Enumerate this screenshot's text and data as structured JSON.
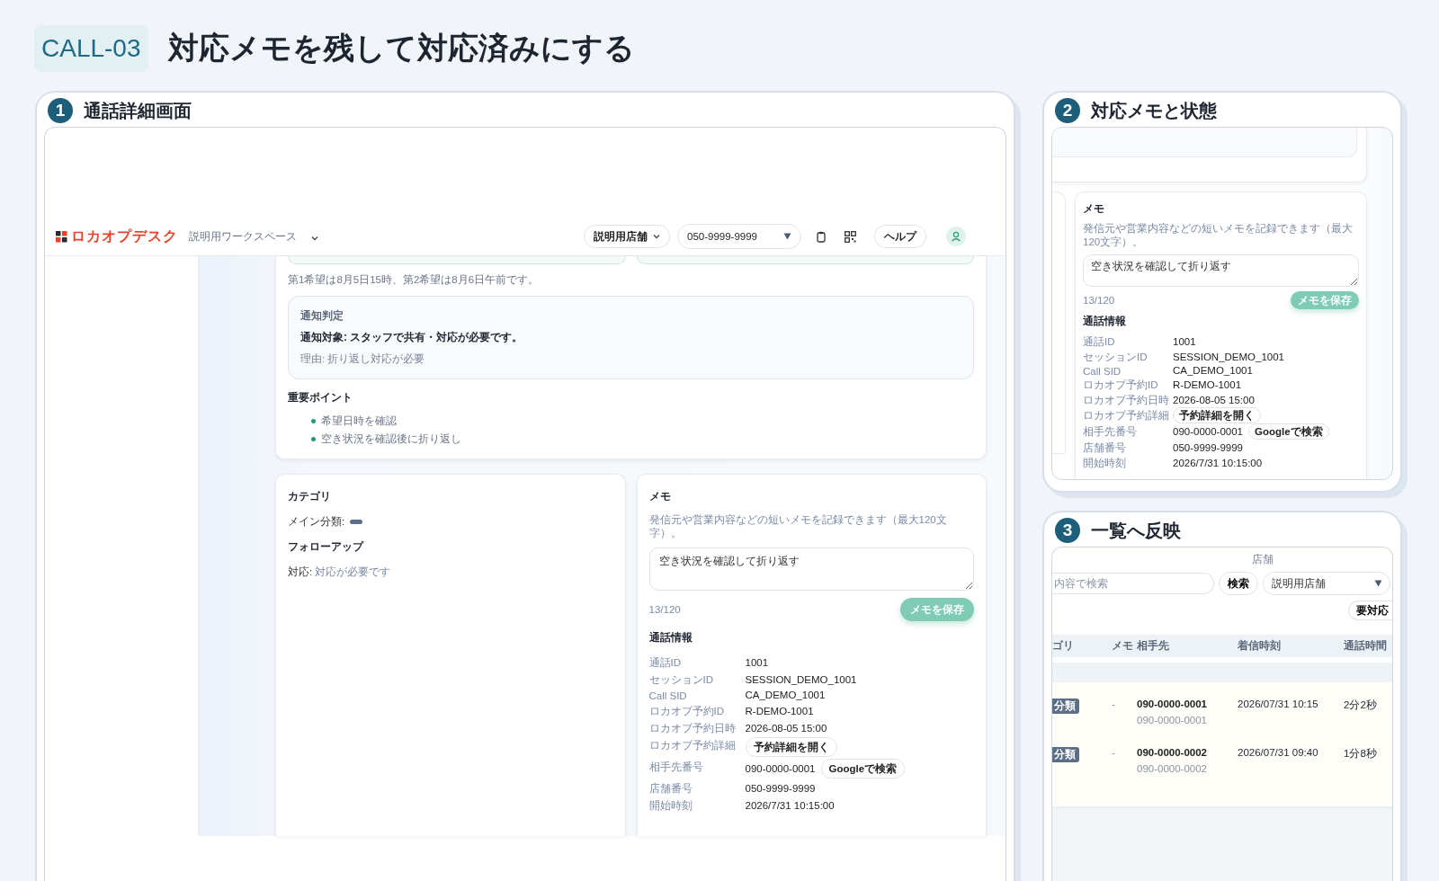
{
  "header": {
    "badge": "CALL-03",
    "title": "対応メモを残して対応済みにする"
  },
  "panel_1": {
    "number": "1",
    "title": "通話詳細画面",
    "app_bar": {
      "logo": "ロカオプデスク",
      "workspace": "説明用ワークスペース",
      "store_button": "説明用店舗",
      "phone_select": "050-9999-9999",
      "help": "ヘルプ"
    },
    "summary_note": "第1希望は8月5日15時、第2希望は8月6日午前です。",
    "notification": {
      "label": "通知判定",
      "text": "通知対象: スタッフで共有・対応が必要です。",
      "reason": "理由: 折り返し対応が必要"
    },
    "key_points": {
      "title": "重要ポイント",
      "items": [
        "希望日時を確認",
        "空き状況を確認後に折り返し"
      ]
    },
    "category": {
      "title": "カテゴリ",
      "main_label": "メイン分類:",
      "followup_title": "フォローアップ",
      "action_label": "対応:",
      "action_value": "対応が必要です"
    },
    "memo": {
      "title": "メモ",
      "hint": "発信元や営業内容などの短いメモを記録できます（最大120文字）。",
      "value": "空き状況を確認して折り返す",
      "count": "13/120",
      "save": "メモを保存",
      "info_title": "通話情報",
      "info": [
        {
          "label": "通話ID",
          "value": "1001"
        },
        {
          "label": "セッションID",
          "value": "SESSION_DEMO_1001"
        },
        {
          "label": "Call SID",
          "value": "CA_DEMO_1001"
        },
        {
          "label": "ロカオプ予約ID",
          "value": "R-DEMO-1001"
        },
        {
          "label": "ロカオプ予約日時",
          "value": "2026-08-05 15:00"
        },
        {
          "label": "ロカオプ予約詳細",
          "button": "予約詳細を開く"
        },
        {
          "label": "相手先番号",
          "value": "090-0000-0001",
          "button": "Googleで検索"
        },
        {
          "label": "店舗番号",
          "value": "050-9999-9999"
        },
        {
          "label": "開始時刻",
          "value": "2026/7/31 10:15:00"
        }
      ]
    }
  },
  "panel_2": {
    "number": "2",
    "title": "対応メモと状態",
    "memo": {
      "title": "メモ",
      "hint": "発信元や営業内容などの短いメモを記録できます（最大120文字）。",
      "value": "空き状況を確認して折り返す",
      "count": "13/120",
      "save": "メモを保存",
      "info_title": "通話情報",
      "info": [
        {
          "label": "通話ID",
          "value": "1001"
        },
        {
          "label": "セッションID",
          "value": "SESSION_DEMO_1001"
        },
        {
          "label": "Call SID",
          "value": "CA_DEMO_1001"
        },
        {
          "label": "ロカオプ予約ID",
          "value": "R-DEMO-1001"
        },
        {
          "label": "ロカオプ予約日時",
          "value": "2026-08-05 15:00"
        },
        {
          "label": "ロカオプ予約詳細",
          "button": "予約詳細を開く"
        },
        {
          "label": "相手先番号",
          "value": "090-0000-0001",
          "button": "Googleで検索"
        },
        {
          "label": "店舗番号",
          "value": "050-9999-9999"
        },
        {
          "label": "開始時刻",
          "value": "2026/7/31 10:15:00"
        }
      ]
    }
  },
  "panel_3": {
    "number": "3",
    "title": "一覧へ反映",
    "store_label": "店舗",
    "search_placeholder": "内容で検索",
    "search_button": "検索",
    "store_select": "説明用店舗",
    "filter_button": "要対応",
    "columns": [
      "ゴリ",
      "メモ",
      "相手先",
      "着信時刻",
      "通話時間"
    ],
    "rows": [
      {
        "category": "分類",
        "memo": "-",
        "caller": "090-0000-0001",
        "caller_sub": "090-0000-0001",
        "time": "2026/07/31 10:15",
        "duration": "2分2秒"
      },
      {
        "category": "分類",
        "memo": "-",
        "caller": "090-0000-0002",
        "caller_sub": "090-0000-0002",
        "time": "2026/07/31 09:40",
        "duration": "1分8秒"
      }
    ]
  }
}
